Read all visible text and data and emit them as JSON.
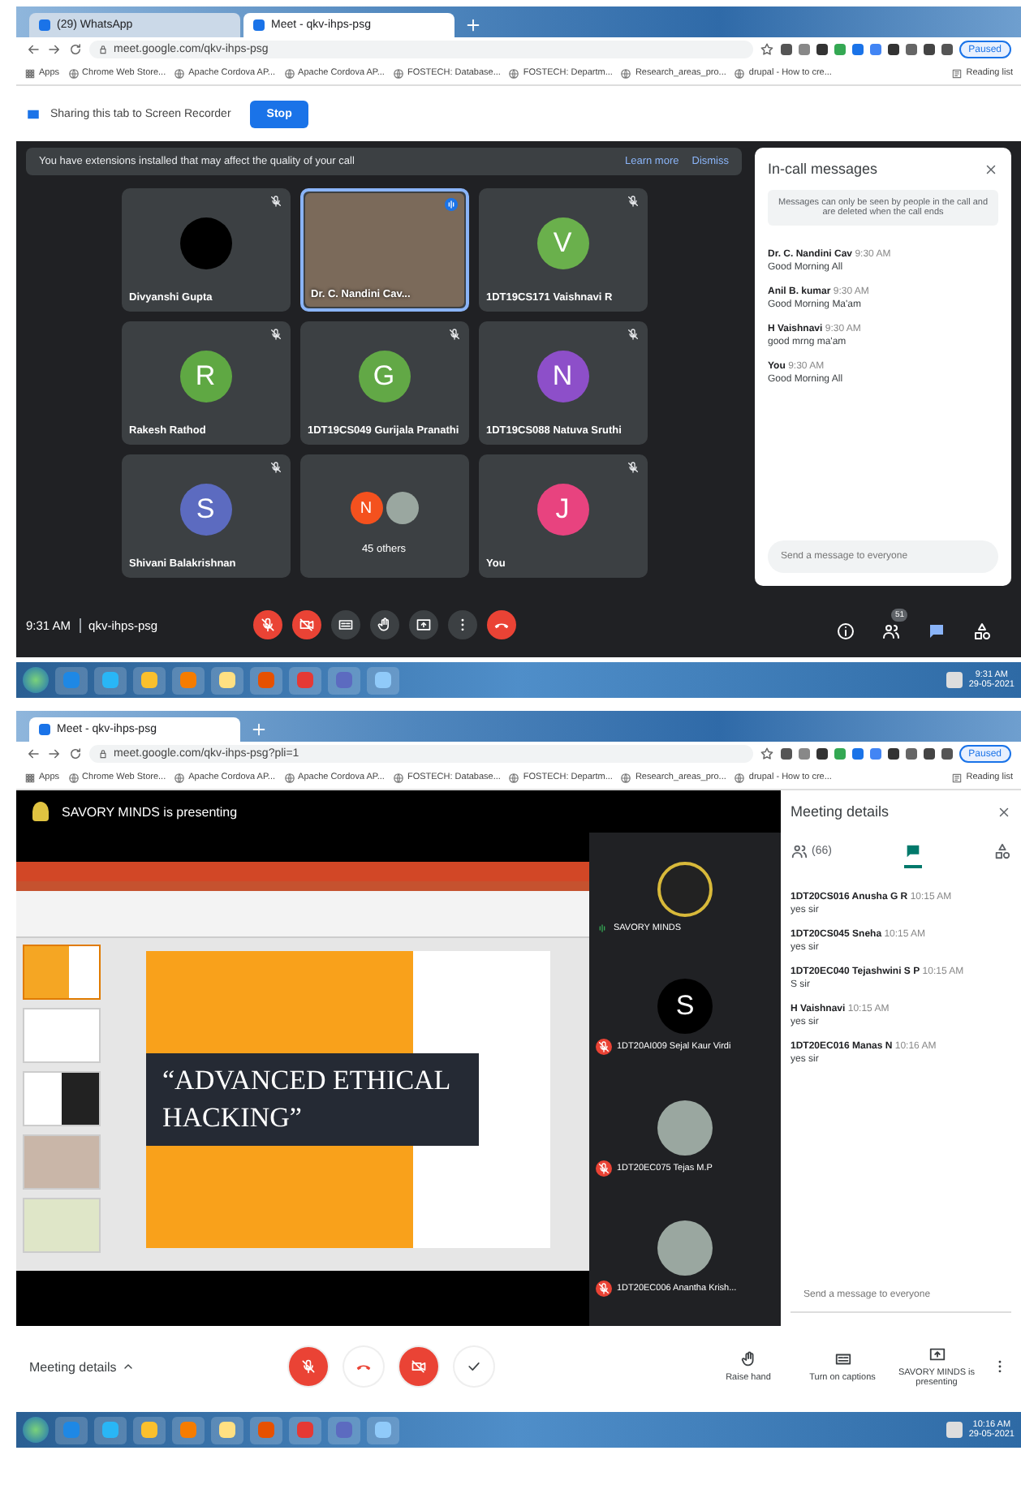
{
  "screens": [
    {
      "kind": "grid",
      "browser": {
        "tabs": [
          {
            "label": "(29) WhatsApp",
            "selected": false
          },
          {
            "label": "Meet - qkv-ihps-psg",
            "selected": true
          }
        ],
        "url": "meet.google.com/qkv-ihps-psg",
        "profile": "Paused",
        "bookmarks": [
          "Apps",
          "Chrome Web Store...",
          "Apache Cordova AP...",
          "Apache Cordova AP...",
          "FOSTECH: Database...",
          "FOSTECH: Departm...",
          "Research_areas_pro...",
          "drupal - How to cre..."
        ],
        "reading_list": "Reading list"
      },
      "share_bar": {
        "text": "Sharing this tab to Screen Recorder",
        "button": "Stop"
      },
      "banner": {
        "text": "You have extensions installed that may affect the quality of your call",
        "links": [
          "Learn more",
          "Dismiss"
        ]
      },
      "tiles": [
        {
          "kind": "avatar",
          "name": "Divyanshi Gupta",
          "color": "#000000",
          "muted": true
        },
        {
          "kind": "video",
          "name": "Dr. C. Nandini Cav...",
          "muted": false
        },
        {
          "kind": "avatar",
          "name": "1DT19CS171 Vaishnavi R",
          "initial": "V",
          "color": "#6ab04c",
          "muted": true
        },
        {
          "kind": "avatar",
          "name": "Rakesh Rathod",
          "initial": "R",
          "color": "#5fa843",
          "muted": true
        },
        {
          "kind": "avatar",
          "name": "1DT19CS049 Gurijala Pranathi",
          "initial": "G",
          "color": "#62a846",
          "muted": true
        },
        {
          "kind": "avatar",
          "name": "1DT19CS088 Natuva Sruthi",
          "initial": "N",
          "color": "#8d4fc9",
          "muted": true
        },
        {
          "kind": "avatar",
          "name": "Shivani Balakrishnan",
          "initial": "S",
          "color": "#5c6bc0",
          "muted": true
        },
        {
          "kind": "others",
          "name": "45 others",
          "initial": "N",
          "color": "#f4511e",
          "muted": false
        },
        {
          "kind": "avatar",
          "name": "You",
          "initial": "J",
          "color": "#e8437f",
          "muted": true
        }
      ],
      "meeting_time": "9:31 AM",
      "meeting_code": "qkv-ihps-psg",
      "controls": [
        {
          "kind": "mic",
          "alert": true
        },
        {
          "kind": "cam",
          "alert": true
        },
        {
          "kind": "captions",
          "alert": false
        },
        {
          "kind": "hand",
          "alert": false
        },
        {
          "kind": "present",
          "alert": false
        },
        {
          "kind": "more",
          "alert": false
        },
        {
          "kind": "leave",
          "alert": true
        }
      ],
      "side_buttons": [
        {
          "kind": "info",
          "selected": false
        },
        {
          "kind": "people",
          "selected": false,
          "badge": "51"
        },
        {
          "kind": "chat",
          "selected": true
        },
        {
          "kind": "activities",
          "selected": false
        }
      ],
      "panel": {
        "title": "In-call messages",
        "note": "Messages can only be seen by people in the call and are deleted when the call ends",
        "messages": [
          {
            "sender": "Dr. C. Nandini Cav",
            "time": "9:30 AM",
            "text": "Good Morning All"
          },
          {
            "sender": "Anil B. kumar",
            "time": "9:30 AM",
            "text": "Good Morning Ma'am"
          },
          {
            "sender": "H Vaishnavi",
            "time": "9:30 AM",
            "text": "good mrng ma'am"
          },
          {
            "sender": "You",
            "time": "9:30 AM",
            "text": "Good Morning All"
          }
        ],
        "placeholder": "Send a message to everyone"
      },
      "taskbar": {
        "time": "9:31 AM",
        "date": "29-05-2021"
      }
    },
    {
      "kind": "presenting",
      "browser": {
        "tabs": [
          {
            "label": "Meet - qkv-ihps-psg",
            "selected": true
          }
        ],
        "url": "meet.google.com/qkv-ihps-psg?pli=1",
        "profile": "Paused",
        "bookmarks": [
          "Apps",
          "Chrome Web Store...",
          "Apache Cordova AP...",
          "Apache Cordova AP...",
          "FOSTECH: Database...",
          "FOSTECH: Departm...",
          "Research_areas_pro...",
          "drupal - How to cre..."
        ],
        "reading_list": "Reading list"
      },
      "presenting_banner": "SAVORY MINDS is presenting",
      "slide": {
        "title": "“ADVANCED ETHICAL HACKING”"
      },
      "presenters": [
        {
          "kind": "logo",
          "name": "SAVORY MINDS",
          "muted": false
        },
        {
          "kind": "avatar",
          "name": "1DT20AI009 Sejal Kaur Virdi",
          "initial": "S",
          "color": "#000000",
          "muted": true
        },
        {
          "kind": "photo",
          "name": "1DT20EC075 Tejas M.P",
          "muted": true
        },
        {
          "kind": "photo",
          "name": "1DT20EC006 Anantha Krish...",
          "muted": true
        }
      ],
      "panel": {
        "title": "Meeting details",
        "tabs": [
          {
            "kind": "people",
            "label": "(66)",
            "selected": false
          },
          {
            "kind": "chat",
            "selected": true
          },
          {
            "kind": "activities",
            "selected": false
          }
        ],
        "messages": [
          {
            "sender": "1DT20CS016 Anusha G R",
            "time": "10:15 AM",
            "text": "yes sir"
          },
          {
            "sender": "1DT20CS045 Sneha",
            "time": "10:15 AM",
            "text": "yes sir"
          },
          {
            "sender": "1DT20EC040 Tejashwini S P",
            "time": "10:15 AM",
            "text": "S sir"
          },
          {
            "sender": "H Vaishnavi",
            "time": "10:15 AM",
            "text": "yes sir"
          },
          {
            "sender": "1DT20EC016 Manas N",
            "time": "10:16 AM",
            "text": "yes sir"
          }
        ],
        "placeholder": "Send a message to everyone"
      },
      "details_button": "Meeting details",
      "controls": [
        {
          "kind": "mic",
          "alert": true
        },
        {
          "kind": "leave",
          "alert": false
        },
        {
          "kind": "cam",
          "alert": true
        },
        {
          "kind": "check",
          "alert": false
        }
      ],
      "actions": [
        {
          "kind": "hand",
          "label": "Raise hand"
        },
        {
          "kind": "captions",
          "label": "Turn on captions"
        },
        {
          "kind": "present",
          "label": "SAVORY MINDS is presenting"
        }
      ],
      "taskbar": {
        "time": "10:16 AM",
        "date": "29-05-2021"
      }
    }
  ]
}
